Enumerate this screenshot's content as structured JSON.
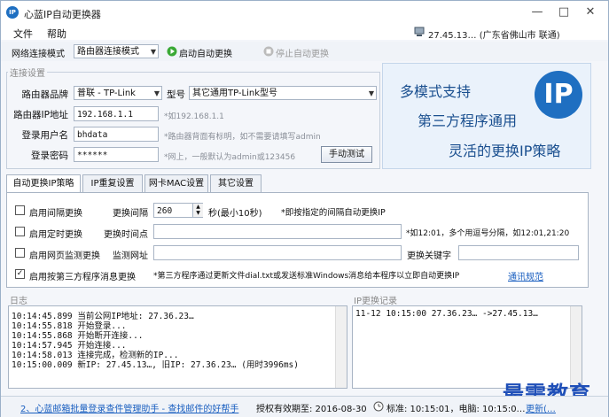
{
  "window": {
    "title": "心蓝IP自动更换器",
    "min": "—",
    "max": "□",
    "close": "✕"
  },
  "menu": {
    "file": "文件",
    "help": "帮助"
  },
  "ipinfo": "27.45.13… (广东省佛山市 联通)",
  "toolbar": {
    "mode_label": "网络连接模式",
    "mode_value": "路由器连接模式",
    "start": "启动自动更换",
    "stop": "停止自动更换"
  },
  "conn": {
    "group": "连接设置",
    "brand_label": "路由器品牌",
    "brand_value": "普联 - TP-Link",
    "model_label": "型号",
    "model_value": "其它通用TP-Link型号",
    "ip_label": "路由器IP地址",
    "ip_value": "192.168.1.1",
    "ip_hint": "*如192.168.1.1",
    "user_label": "登录用户名",
    "user_value": "bhdata",
    "user_hint": "*路由器背面有标明，如不需要请填写admin",
    "pwd_label": "登录密码",
    "pwd_value": "******",
    "pwd_hint": "*网上，一般默认为admin或123456",
    "test_button": "手动测试"
  },
  "banner": {
    "line1": "多模式支持",
    "line2": "第三方程序通用",
    "line3": "灵活的更换IP策略",
    "logo": "IP"
  },
  "tabs": [
    "自动更换IP策略",
    "IP重复设置",
    "网卡MAC设置",
    "其它设置"
  ],
  "strategy": {
    "interval_label": "启用间隔更换",
    "interval_field": "更换间隔",
    "interval_value": "260",
    "interval_unit": "秒(最小10秒)",
    "interval_hint": "*即按指定的间隔自动更换IP",
    "timed_label": "启用定时更换",
    "timed_field": "更换时间点",
    "timed_hint": "*如12:01，多个用逗号分隔，如12:01,21:20",
    "web_label": "启用网页监测更换",
    "web_field": "监测网址",
    "web_keyword": "更换关键字",
    "third_label": "启用按第三方程序消息更换",
    "third_hint": "*第三方程序通过更新文件dial.txt或发送标准Windows消息给本程序以立即自动更换IP",
    "third_link": "通讯规范"
  },
  "log": {
    "title": "日志",
    "lines": [
      "10:14:45.899 当前公网IP地址: 27.36.23…",
      "10:14:55.818 开始登录...",
      "10:14:55.868 开始断开连接...",
      "10:14:57.945 开始连接...",
      "10:14:58.013 连接完成，检测新的IP...",
      "10:15:00.009 新IP: 27.45.13…, 旧IP: 27.36.23… (用时3996ms)"
    ]
  },
  "iplog": {
    "title": "IP更换记录",
    "lines": [
      "11-12 10:15:00 27.36.23… ->27.45.13…"
    ]
  },
  "status": {
    "promo": "2、心蓝邮箱批量登录查件管理助手 - 查找邮件的好帮手",
    "license": "授权有效期至: 2016-08-30",
    "time": "标准: 10:15:01，电脑: 10:15:0…",
    "extra": "更新(…"
  },
  "watermark": "最需教育",
  "colors": {
    "accent": "#1f6fc1",
    "link": "#1a5fc0"
  }
}
